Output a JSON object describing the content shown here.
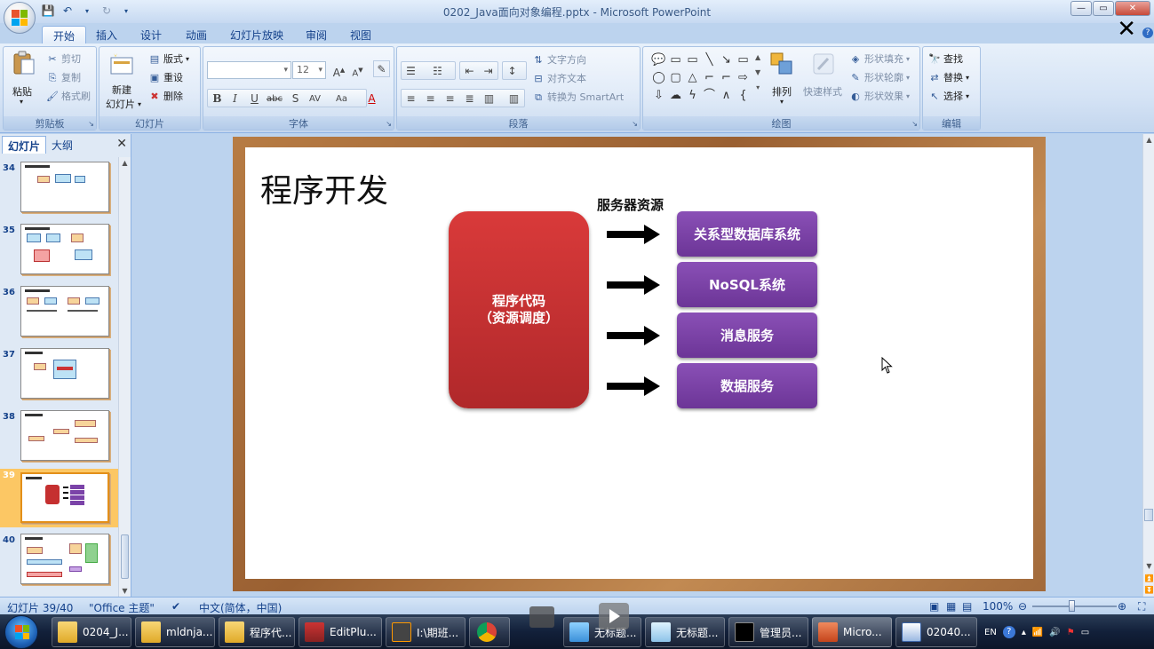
{
  "window": {
    "title": "0202_Java面向对象编程.pptx - Microsoft PowerPoint",
    "min": "—",
    "max": "▭",
    "close": "✕"
  },
  "ribbon_tabs": [
    "开始",
    "插入",
    "设计",
    "动画",
    "幻灯片放映",
    "审阅",
    "视图"
  ],
  "ribbon": {
    "clipboard": {
      "label": "剪贴板",
      "paste": "粘贴",
      "cut": "剪切",
      "copy": "复制",
      "format_painter": "格式刷"
    },
    "slides": {
      "label": "幻灯片",
      "new_slide_1": "新建",
      "new_slide_2": "幻灯片",
      "layout": "版式",
      "reset": "重设",
      "delete": "删除"
    },
    "font": {
      "label": "字体",
      "font_size": "12"
    },
    "paragraph": {
      "label": "段落",
      "text_direction": "文字方向",
      "align_text": "对齐文本",
      "smartart": "转换为 SmartArt"
    },
    "drawing": {
      "label": "绘图",
      "arrange": "排列",
      "quick_styles": "快速样式",
      "shape_fill": "形状填充",
      "shape_outline": "形状轮廓",
      "shape_effects": "形状效果"
    },
    "editing": {
      "label": "编辑",
      "find": "查找",
      "replace": "替换",
      "select": "选择"
    }
  },
  "left_pane": {
    "tab_slides": "幻灯片",
    "tab_outline": "大纲",
    "slide_numbers": [
      "34",
      "35",
      "36",
      "37",
      "38",
      "39",
      "40"
    ],
    "selected": "39"
  },
  "slide": {
    "title": "程序开发",
    "resource_label": "服务器资源",
    "code_line1": "程序代码",
    "code_line2": "（资源调度）",
    "services": [
      "关系型数据库系统",
      "NoSQL系统",
      "消息服务",
      "数据服务"
    ],
    "colors": {
      "code_box": "#c53030",
      "service_box": "#7b43a8",
      "frame": "#a86a38"
    }
  },
  "status": {
    "slide_pos": "幻灯片 39/40",
    "theme": "\"Office 主题\"",
    "language": "中文(简体，中国)",
    "zoom": "100%"
  },
  "taskbar": {
    "items": [
      "0204_J...",
      "mldnja...",
      "程序代...",
      "EditPlu...",
      "I:\\期班...",
      "",
      "无标题...",
      "无标题...",
      "管理员...",
      "Micro...",
      "02040..."
    ],
    "tray_lang": "EN"
  }
}
